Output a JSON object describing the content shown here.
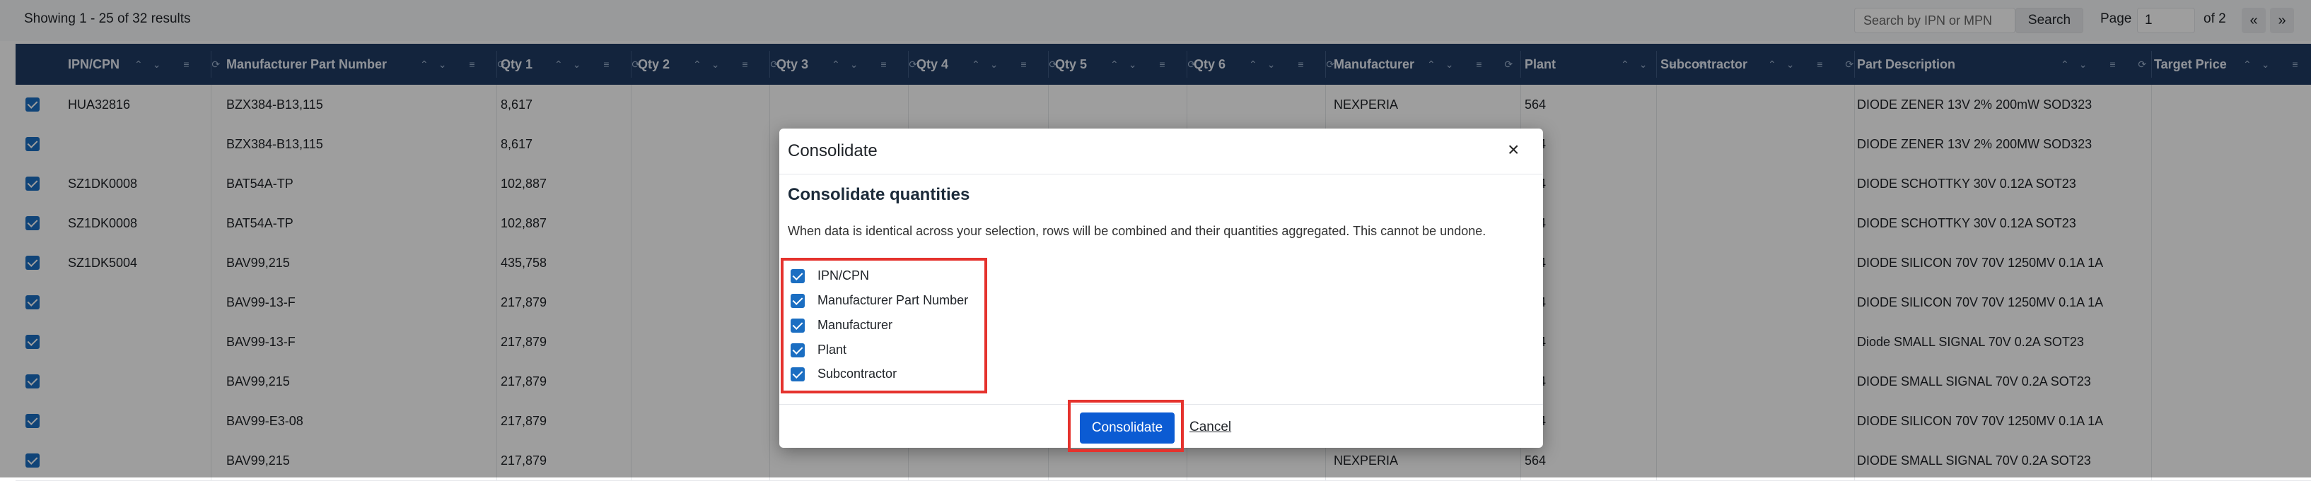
{
  "toolbar": {
    "results_text": "Showing 1 - 25 of 32 results",
    "search_placeholder": "Search by IPN or MPN",
    "search_label": "Search",
    "page_label": "Page",
    "page_value": "1",
    "of_label": "of 2",
    "prev_label": "«",
    "next_label": "»"
  },
  "columns": [
    "IPN/CPN",
    "Manufacturer Part Number",
    "Qty 1",
    "Qty 2",
    "Qty 3",
    "Qty 4",
    "Qty 5",
    "Qty 6",
    "Manufacturer",
    "Plant",
    "Subcontractor",
    "Part Description",
    "Target Price"
  ],
  "column_icons": "⌃⌄ ≡ ⟳",
  "rows": [
    {
      "ipn": "HUA32816",
      "mpn": "BZX384-B13,115",
      "qty1": "8,617",
      "manufacturer": "NEXPERIA",
      "plant": "564",
      "description": "DIODE ZENER 13V 2% 200mW SOD323"
    },
    {
      "ipn": "",
      "mpn": "BZX384-B13,115",
      "qty1": "8,617",
      "manufacturer": "",
      "plant": "564",
      "description": "DIODE ZENER 13V 2% 200MW SOD323"
    },
    {
      "ipn": "SZ1DK0008",
      "mpn": "BAT54A-TP",
      "qty1": "102,887",
      "manufacturer": "",
      "plant": "564",
      "description": "DIODE SCHOTTKY 30V 0.12A SOT23"
    },
    {
      "ipn": "SZ1DK0008",
      "mpn": "BAT54A-TP",
      "qty1": "102,887",
      "manufacturer": "",
      "plant": "564",
      "description": "DIODE SCHOTTKY 30V 0.12A SOT23"
    },
    {
      "ipn": "SZ1DK5004",
      "mpn": "BAV99,215",
      "qty1": "435,758",
      "manufacturer": "",
      "plant": "564",
      "description": "DIODE SILICON 70V 70V 1250MV 0.1A 1A"
    },
    {
      "ipn": "",
      "mpn": "BAV99-13-F",
      "qty1": "217,879",
      "manufacturer": "",
      "plant": "564",
      "description": "DIODE SILICON 70V 70V 1250MV 0.1A 1A"
    },
    {
      "ipn": "",
      "mpn": "BAV99-13-F",
      "qty1": "217,879",
      "manufacturer": "",
      "plant": "564",
      "description": "Diode SMALL SIGNAL 70V 0.2A SOT23"
    },
    {
      "ipn": "",
      "mpn": "BAV99,215",
      "qty1": "217,879",
      "manufacturer": "",
      "plant": "564",
      "description": "DIODE SMALL SIGNAL 70V 0.2A SOT23"
    },
    {
      "ipn": "",
      "mpn": "BAV99-E3-08",
      "qty1": "217,879",
      "manufacturer": "",
      "plant": "564",
      "description": "DIODE SILICON 70V 70V 1250MV 0.1A 1A"
    },
    {
      "ipn": "",
      "mpn": "BAV99,215",
      "qty1": "217,879",
      "manufacturer": "NEXPERIA",
      "plant": "564",
      "description": "DIODE SMALL SIGNAL 70V 0.2A SOT23"
    }
  ],
  "modal": {
    "title": "Consolidate",
    "close_label": "×",
    "subtitle": "Consolidate quantities",
    "description": "When data is identical across your selection, rows will be combined and their quantities aggregated. This cannot be undone.",
    "options": [
      {
        "label": "IPN/CPN",
        "checked": true
      },
      {
        "label": "Manufacturer Part Number",
        "checked": true
      },
      {
        "label": "Manufacturer",
        "checked": true
      },
      {
        "label": "Plant",
        "checked": true
      },
      {
        "label": "Subcontractor",
        "checked": true
      }
    ],
    "confirm_label": "Consolidate",
    "cancel_label": "Cancel"
  },
  "colors": {
    "header_bg": "#1f3b63",
    "primary": "#0b5bd3",
    "checkbox": "#1b6ec2",
    "highlight": "#e5322d"
  }
}
